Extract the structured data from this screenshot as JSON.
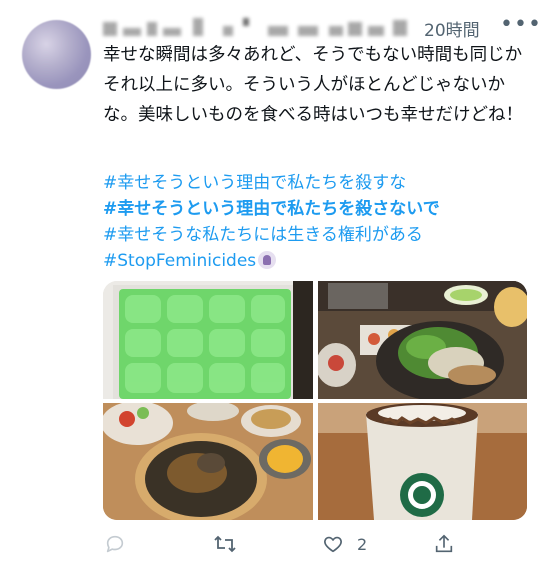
{
  "tweet": {
    "time": "20時間",
    "more": "•••",
    "text": "幸せな瞬間は多々あれど、そうでもない時間も同じかそれ以上に多い。そういう人がほとんどじゃないかな。美味しいものを食べる時はいつも幸せだけどね！",
    "hashtags": [
      "#幸せそうという理由で私たちを殺すな",
      "#幸せそうという理由で私たちを殺さないで",
      "#幸せそうな私たちには生きる権利がある",
      "#StopFeminicides"
    ]
  },
  "actions": {
    "like_count": "2"
  },
  "colors": {
    "link": "#1d9bf0",
    "muted": "#536471",
    "text": "#0f1419"
  },
  "icons": [
    "reply-icon",
    "retweet-icon",
    "like-icon",
    "share-icon",
    "more-icon",
    "feminist-icon"
  ]
}
